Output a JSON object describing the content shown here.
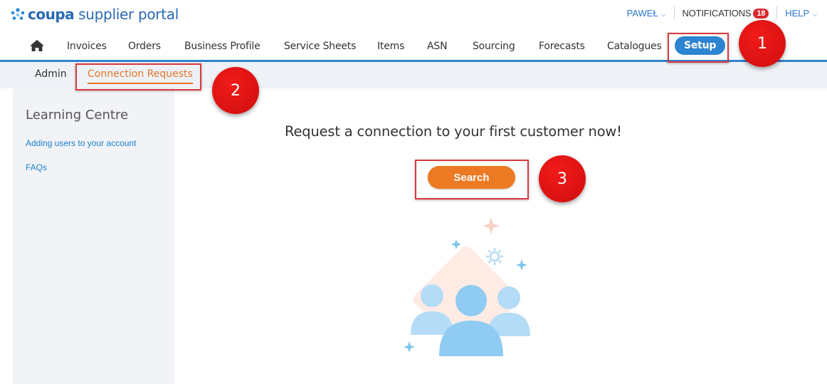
{
  "header": {
    "brand": "coupa",
    "brand_rest": "supplier portal",
    "user": "PAWEŁ",
    "notifications_label": "NOTIFICATIONS",
    "notifications_count": "18",
    "help_label": "HELP"
  },
  "nav": {
    "items": [
      "Invoices",
      "Orders",
      "Business Profile",
      "Service Sheets",
      "Items",
      "ASN",
      "Sourcing",
      "Forecasts",
      "Catalogues",
      "Setup"
    ],
    "active": "Setup"
  },
  "subnav": {
    "items": [
      "Admin",
      "Connection Requests"
    ],
    "active": "Connection Requests"
  },
  "sidebar": {
    "title": "Learning Centre",
    "links": [
      "Adding users to your account",
      "FAQs"
    ]
  },
  "main": {
    "headline": "Request a connection to your first customer now!",
    "search_label": "Search"
  },
  "annotations": [
    "1",
    "2",
    "3"
  ],
  "colors": {
    "brand_blue": "#2a69b3",
    "nav_underline": "#2f83cf",
    "accent_orange": "#ec7a22",
    "annotation_red": "#d9383f"
  }
}
